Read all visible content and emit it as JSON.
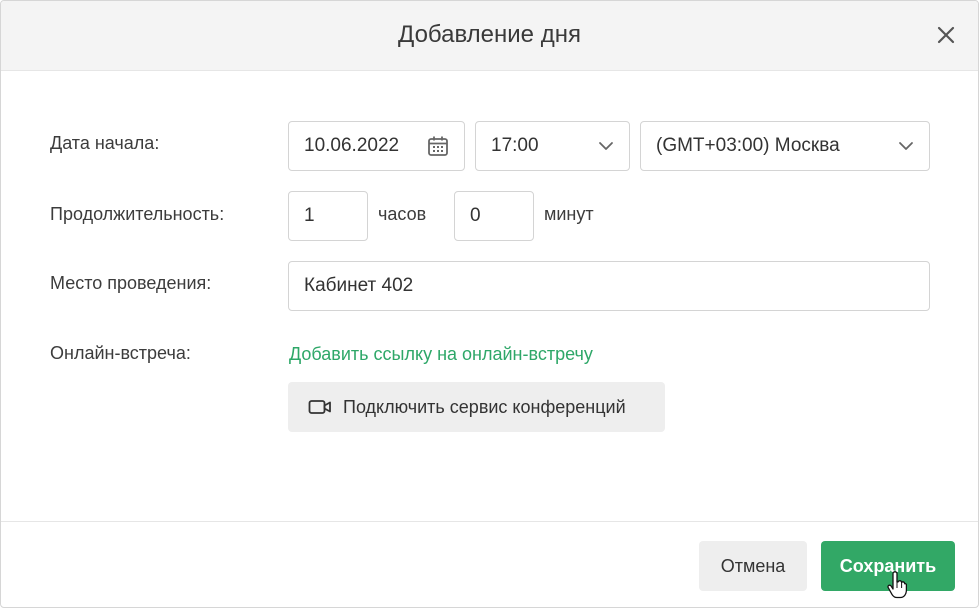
{
  "dialog": {
    "title": "Добавление дня"
  },
  "form": {
    "start_date_label": "Дата начала:",
    "start_date_value": "10.06.2022",
    "start_time_value": "17:00",
    "timezone_value": "(GMT+03:00) Москва",
    "duration_label": "Продолжительность:",
    "duration_hours_value": "1",
    "hours_unit": "часов",
    "duration_minutes_value": "0",
    "minutes_unit": "минут",
    "location_label": "Место проведения:",
    "location_value": "Кабинет 402",
    "online_label": "Онлайн-встреча:",
    "online_link_text": "Добавить ссылку на онлайн-встречу",
    "conference_button_label": "Подключить сервис конференций"
  },
  "footer": {
    "cancel_label": "Отмена",
    "save_label": "Сохранить"
  },
  "icons": {
    "close": "close-icon",
    "calendar": "calendar-icon",
    "chevron": "chevron-down-icon",
    "video": "video-camera-icon",
    "cursor": "hand-pointer-icon"
  },
  "colors": {
    "accent": "#32a866",
    "link": "#2ea768",
    "header_bg": "#f4f4f4",
    "secondary_button_bg": "#eeeeee"
  }
}
